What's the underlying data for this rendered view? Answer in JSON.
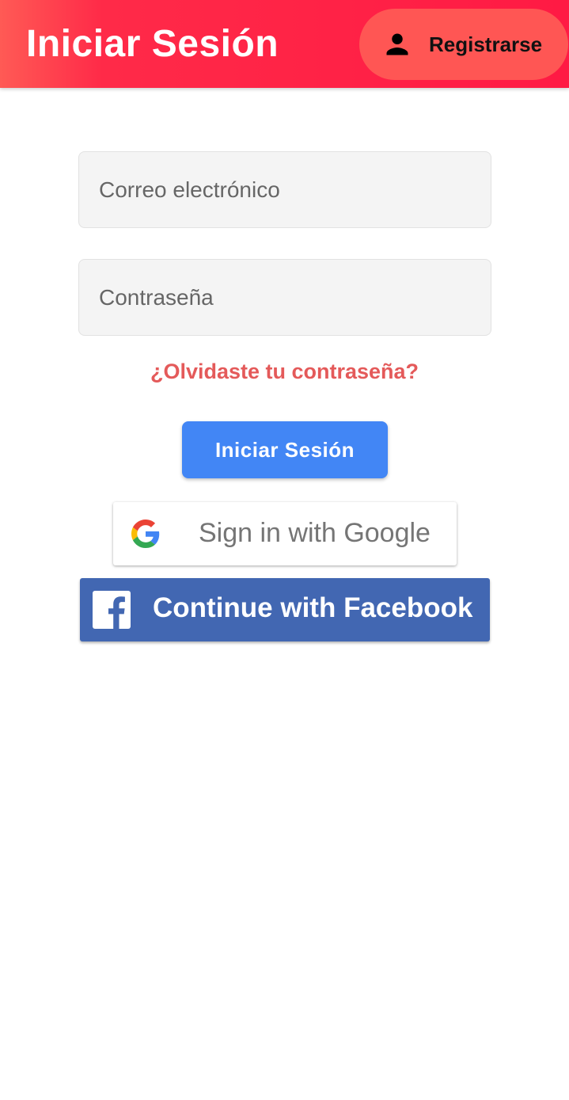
{
  "header": {
    "title": "Iniciar Sesión",
    "register_label": "Registrarse",
    "register_icon": "person-icon"
  },
  "form": {
    "email_placeholder": "Correo electrónico",
    "email_value": "",
    "password_placeholder": "Contraseña",
    "password_value": "",
    "forgot_label": "¿Olvidaste tu contraseña?",
    "login_label": "Iniciar Sesión"
  },
  "social": {
    "google_label": "Sign in with Google",
    "google_icon": "google-g-icon",
    "facebook_label": "Continue with Facebook",
    "facebook_icon": "facebook-f-icon"
  },
  "colors": {
    "header_gradient_start": "#ff5a55",
    "header_gradient_end": "#ff1a44",
    "register_button": "#ff5654",
    "forgot_link": "#e45a5a",
    "login_button": "#4286f5",
    "facebook_button": "#4267b2"
  }
}
